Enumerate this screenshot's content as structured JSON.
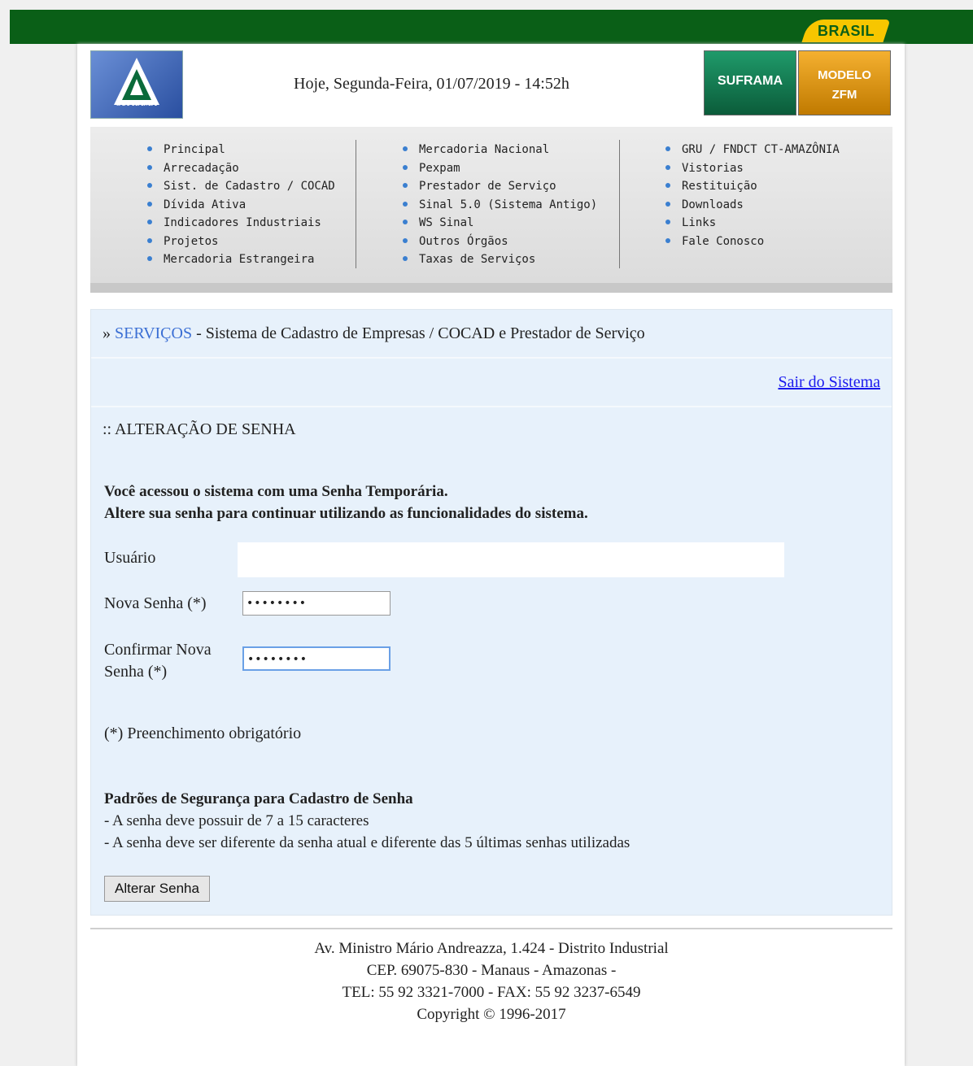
{
  "banner": {
    "brasil": "BRASIL"
  },
  "header": {
    "logo_text": "SUFRAMA",
    "date": "Hoje, Segunda-Feira, 01/07/2019 - 14:52h",
    "suframa_button": "SUFRAMA",
    "modelo_line1": "MODELO",
    "modelo_line2": "ZFM"
  },
  "menu": {
    "col1": [
      "Principal",
      "Arrecadação",
      "Sist. de Cadastro / COCAD",
      "Dívida Ativa",
      "Indicadores Industriais",
      "Projetos",
      "Mercadoria Estrangeira"
    ],
    "col2": [
      "Mercadoria Nacional",
      "Pexpam",
      "Prestador de Serviço",
      "Sinal 5.0 (Sistema Antigo)",
      "WS Sinal",
      "Outros Órgãos",
      "Taxas de Serviços"
    ],
    "col3": [
      "GRU / FNDCT CT-AMAZÔNIA",
      "Vistorias",
      "Restituição",
      "Downloads",
      "Links",
      "Fale Conosco"
    ]
  },
  "breadcrumb": {
    "prefix": "» ",
    "section": "SERVIÇOS",
    "rest": " - Sistema de Cadastro de Empresas / COCAD e Prestador de Serviço"
  },
  "logout_link": "Sair do Sistema",
  "form": {
    "title": ":: ALTERAÇÃO DE SENHA",
    "notice_line1": "Você acessou o sistema com uma Senha Temporária.",
    "notice_line2": "Altere sua senha para continuar utilizando as funcionalidades do sistema.",
    "user_label": "Usuário",
    "user_value": "",
    "new_pw_label": "Nova Senha (*)",
    "new_pw_value": "••••••••",
    "confirm_pw_label_line1": "Confirmar Nova",
    "confirm_pw_label_line2": "Senha (*)",
    "confirm_pw_value": "••••••••",
    "required_note": "(*) Preenchimento obrigatório",
    "rules_title": "Padrões de Segurança para Cadastro de Senha",
    "rule1": "- A senha deve possuir de 7 a 15 caracteres",
    "rule2": "- A senha deve ser diferente da senha atual e diferente das 5 últimas senhas utilizadas",
    "submit_label": "Alterar Senha"
  },
  "footer": {
    "line1": "Av. Ministro Mário Andreazza, 1.424 - Distrito Industrial",
    "line2": "CEP. 69075-830 - Manaus - Amazonas -",
    "line3": "TEL: 55 92 3321-7000 - FAX: 55 92 3237-6549",
    "line4": "Copyright © 1996-2017"
  }
}
